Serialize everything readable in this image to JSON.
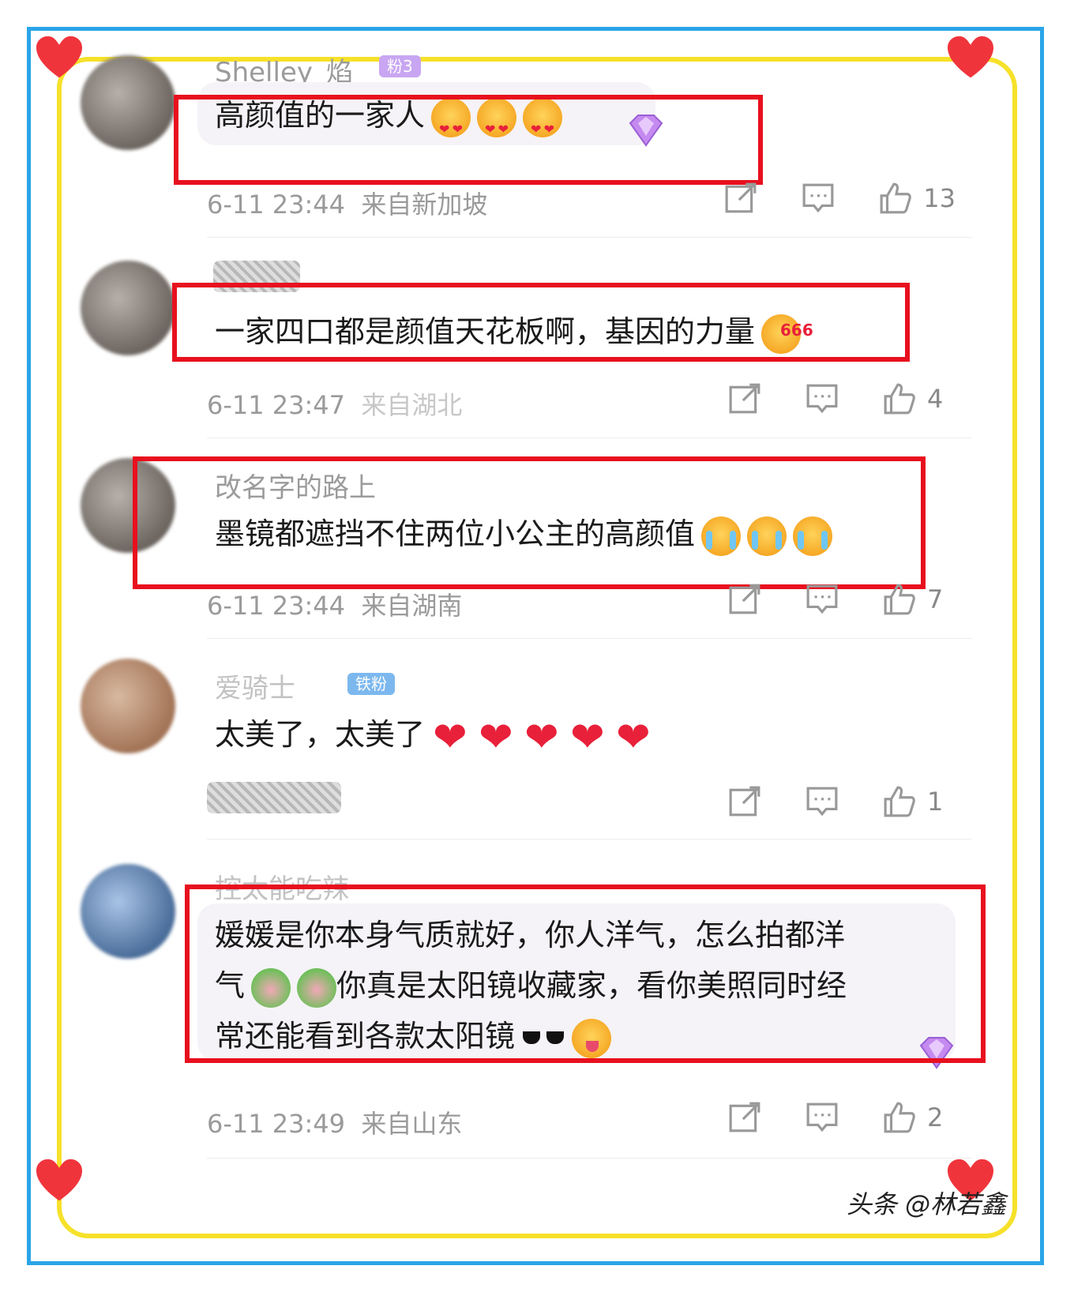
{
  "comments": [
    {
      "username": "Shelley_焰",
      "badge": "粉3",
      "text": "高颜值的一家人",
      "time": "6-11 23:44",
      "location": "来自新加坡",
      "likes": "13"
    },
    {
      "username": "",
      "badge": "",
      "text": "一家四口都是颜值天花板啊，基因的力量",
      "time": "6-11 23:47",
      "location": "来自湖北",
      "likes": "4"
    },
    {
      "username": "改名字的路上",
      "badge": "",
      "text": "墨镜都遮挡不住两位小公主的高颜值",
      "time": "6-11 23:44",
      "location": "来自湖南",
      "likes": "7"
    },
    {
      "username": "爱骑士",
      "badge": "铁粉",
      "text": "太美了，太美了",
      "time": "",
      "location": "",
      "likes": "1"
    },
    {
      "username": "控太能吃辣",
      "badge": "",
      "text_line1": "媛媛是你本身气质就好，你人洋气，怎么拍都洋",
      "text_line2a": "气",
      "text_line2b": "你真是太阳镜收藏家，看你美照同时经",
      "text_line3": "常还能看到各款太阳镜",
      "time": "6-11 23:49",
      "location": "来自山东",
      "likes": "2"
    }
  ],
  "emoji_666": "666",
  "watermark": "头条 @林若鑫",
  "icons": [
    "share-icon",
    "comment-icon",
    "like-icon",
    "vip-diamond-icon",
    "heart-icon"
  ],
  "colors": {
    "highlight_box": "#e8101e",
    "outer_frame": "#2aa5e8",
    "inner_frame": "#f6e12a",
    "meta_text": "#9a9a9a"
  }
}
